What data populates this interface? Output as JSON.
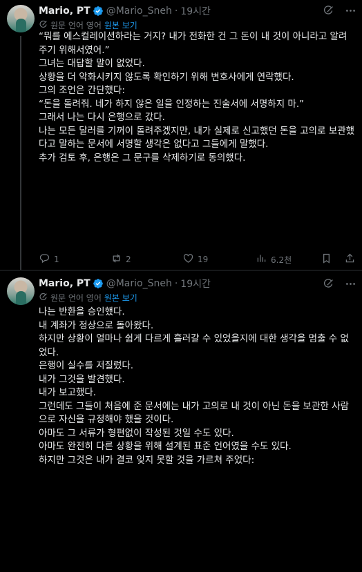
{
  "tweets": [
    {
      "author": {
        "name": "Mario, PT",
        "handle": "@Mario_Sneh"
      },
      "separator": "·",
      "time": "19시간",
      "translate": {
        "label": "원문 언어 영어",
        "link": "원본 보기"
      },
      "paragraphs": [
        "“뭐를 에스컬레이션하라는 거지? 내가 전화한 건 그 돈이 내 것이 아니라고 알려주기 위해서였어.”",
        "그녀는 대답할 말이 없었다.",
        "상황을 더 악화시키지 않도록 확인하기 위해 변호사에게 연락했다.",
        "그의 조언은 간단했다:",
        "“돈을 돌려줘. 네가 하지 않은 일을 인정하는 진술서에 서명하지 마.”",
        "그래서 나는 다시 은행으로 갔다.",
        "나는 모든 달러를 기꺼이 돌려주겠지만, 내가 실제로 신고했던 돈을 고의로 보관했다고 말하는 문서에 서명할 생각은 없다고 그들에게 말했다.",
        "추가 검토 후, 은행은 그 문구를 삭제하기로 동의했다."
      ],
      "actions": {
        "replies": "1",
        "reposts": "2",
        "likes": "19",
        "views": "6.2천"
      }
    },
    {
      "author": {
        "name": "Mario, PT",
        "handle": "@Mario_Sneh"
      },
      "separator": "·",
      "time": "19시간",
      "translate": {
        "label": "원문 언어 영어",
        "link": "원본 보기"
      },
      "paragraphs": [
        "나는 반환을 승인했다.",
        "내 계좌가 정상으로 돌아왔다.",
        "하지만 상황이 얼마나 쉽게 다르게 흘러갈 수 있었을지에 대한 생각을 멈출 수 없었다.",
        "은행이 실수를 저질렀다.",
        "내가 그것을 발견했다.",
        "내가 보고했다.",
        "그런데도 그들이 처음에 준 문서에는 내가 고의로 내 것이 아닌 돈을 보관한 사람으로 자신을 규정해야 했을 것이다.",
        "아마도 그 서류가 형편없이 작성된 것일 수도 있다.",
        "아마도 완전히 다른 상황을 위해 설계된 표준 언어였을 수도 있다.",
        "하지만 그것은 내가 결코 잊지 못할 것을 가르쳐 주었다:"
      ]
    }
  ],
  "colors": {
    "background": "#000000",
    "text": "#e7e9ea",
    "muted": "#71767b",
    "link": "#1d9bf0",
    "verified": "#1d9bf0"
  },
  "icons": [
    "grok-icon",
    "more-icon",
    "translate-icon",
    "reply-icon",
    "repost-icon",
    "like-icon",
    "views-icon",
    "bookmark-icon",
    "share-icon",
    "verified-badge-icon"
  ]
}
